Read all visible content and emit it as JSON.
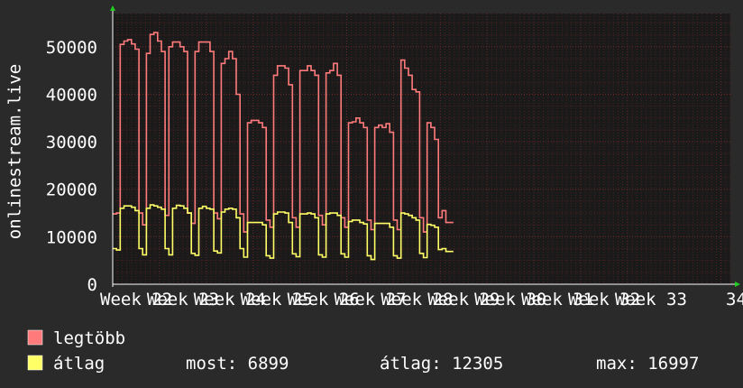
{
  "colors": {
    "background": "#2a2a2a",
    "plot_background": "#1a1a1a",
    "grid_minor": "#4a2020",
    "grid_major": "#6a2a2a",
    "axis": "#ffffff",
    "arrow": "#22cc22",
    "max_series": "#ff7b7b",
    "avg_series": "#ffff66"
  },
  "legend": {
    "max_label": "legtöbb",
    "avg_label": "átlag",
    "stat_most": "most: 6899",
    "stat_atlag": "átlag: 12305",
    "stat_max": "max: 16997"
  },
  "chart_data": {
    "type": "line",
    "ylabel": "onlinestream.live",
    "ylim": [
      0,
      57000
    ],
    "yticks": [
      0,
      10000,
      20000,
      30000,
      40000,
      50000
    ],
    "xlim": [
      0,
      26.4
    ],
    "xticks": [
      {
        "pos": 0,
        "label": "Week 22"
      },
      {
        "pos": 2,
        "label": "Week 23"
      },
      {
        "pos": 4,
        "label": "Week 24"
      },
      {
        "pos": 6,
        "label": "Week 25"
      },
      {
        "pos": 8,
        "label": "Week 26"
      },
      {
        "pos": 10,
        "label": "Week 27"
      },
      {
        "pos": 12,
        "label": "Week 28"
      },
      {
        "pos": 14,
        "label": "Week 29"
      },
      {
        "pos": 16,
        "label": "Week 30"
      },
      {
        "pos": 18,
        "label": "Week 31"
      },
      {
        "pos": 20,
        "label": "Week 32"
      },
      {
        "pos": 22,
        "label": "Week 33"
      },
      {
        "pos": 26.4,
        "label": "34"
      }
    ],
    "grid": true,
    "series": [
      {
        "name": "legtöbb",
        "step": 0.16,
        "values": [
          14800,
          15000,
          50500,
          51200,
          51500,
          50600,
          49500,
          15000,
          12500,
          48600,
          52600,
          53000,
          51200,
          49000,
          14500,
          50000,
          51000,
          51000,
          50000,
          49000,
          15000,
          12800,
          49000,
          51000,
          51000,
          51000,
          49000,
          15000,
          13800,
          46500,
          47500,
          49000,
          47500,
          40000,
          14800,
          11000,
          34000,
          34500,
          34500,
          34000,
          33000,
          13500,
          12000,
          44000,
          46000,
          46000,
          45500,
          42000,
          14000,
          12000,
          45000,
          45000,
          46000,
          45000,
          44000,
          14500,
          12500,
          44500,
          45000,
          46500,
          44000,
          14000,
          12000,
          34000,
          34200,
          35000,
          34000,
          33000,
          13500,
          11500,
          33000,
          33500,
          33000,
          33800,
          32000,
          13500,
          11500,
          47200,
          45500,
          44000,
          41000,
          40500,
          14000,
          11000,
          34000,
          33000,
          30500,
          14000,
          15500,
          13000,
          13000
        ]
      },
      {
        "name": "átlag",
        "step": 0.16,
        "values": [
          7500,
          7200,
          16000,
          16500,
          16500,
          16200,
          15500,
          7500,
          6200,
          16000,
          16700,
          16500,
          16200,
          15800,
          7500,
          6200,
          16000,
          16600,
          16500,
          16000,
          15000,
          6500,
          6100,
          16000,
          16400,
          16000,
          15800,
          7000,
          6600,
          15200,
          15800,
          16000,
          15800,
          14000,
          7500,
          5700,
          13000,
          13000,
          13000,
          13000,
          12500,
          6000,
          5500,
          14800,
          15200,
          15200,
          15000,
          13000,
          6400,
          5800,
          14800,
          14800,
          15000,
          14800,
          14000,
          6200,
          5700,
          14800,
          15000,
          15000,
          14500,
          6400,
          5700,
          13200,
          13500,
          13500,
          13000,
          12700,
          6000,
          5200,
          12800,
          12800,
          12800,
          12800,
          12000,
          6000,
          5500,
          15000,
          14800,
          14500,
          14000,
          13500,
          6500,
          5600,
          12600,
          12400,
          12000,
          7300,
          7500,
          6900,
          6900
        ]
      }
    ]
  }
}
